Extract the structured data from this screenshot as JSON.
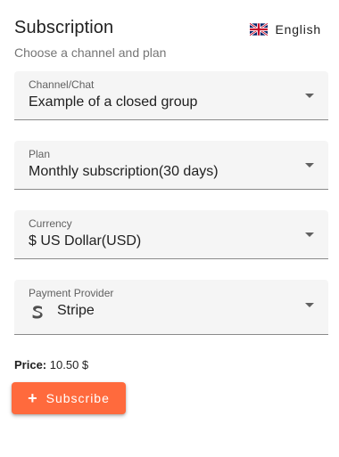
{
  "header": {
    "title": "Subscription",
    "subtitle": "Choose a channel and plan"
  },
  "language": {
    "label": "English",
    "flag_icon": "uk-flag-icon"
  },
  "fields": {
    "channel": {
      "label": "Channel/Chat",
      "value": "Example of a closed group"
    },
    "plan": {
      "label": "Plan",
      "value": "Monthly subscription(30 days)"
    },
    "currency": {
      "label": "Currency",
      "value": "$ US Dollar(USD)"
    },
    "provider": {
      "label": "Payment Provider",
      "value": "Stripe",
      "icon": "stripe-icon"
    }
  },
  "price": {
    "label": "Price:",
    "value": "10.50 $"
  },
  "actions": {
    "subscribe_label": "Subscribe",
    "subscribe_icon": "plus-icon"
  },
  "colors": {
    "accent": "#ff6a3d",
    "field_background": "#f5f5f5"
  }
}
